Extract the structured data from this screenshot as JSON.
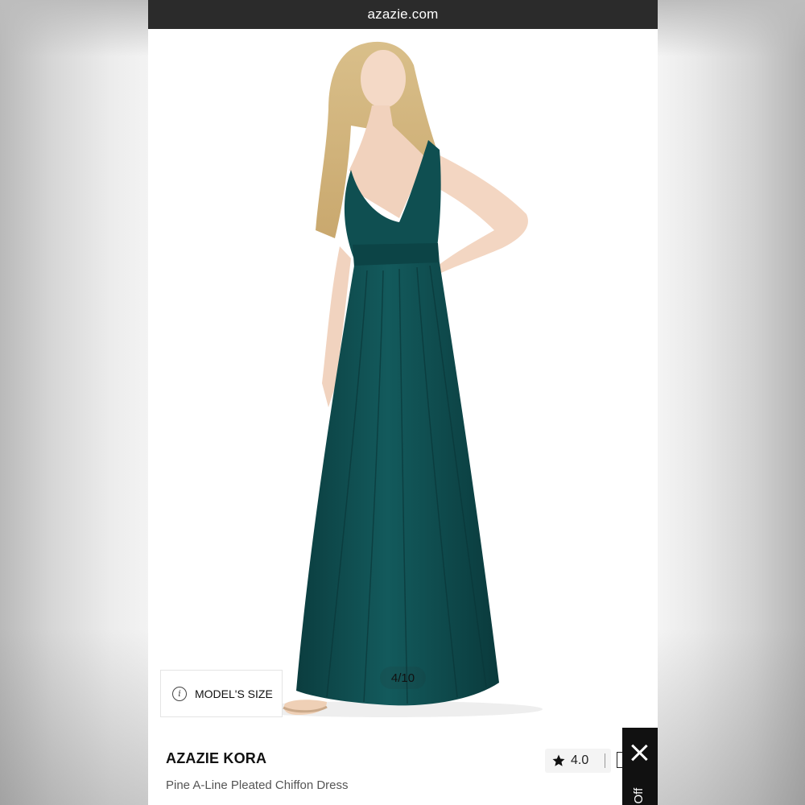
{
  "browser": {
    "url": "azazie.com"
  },
  "gallery": {
    "models_size_label": "MODEL'S SIZE",
    "counter": "4/10",
    "dress_color": "#0f4a4c",
    "image_subject": "model-wearing-dress"
  },
  "product": {
    "brand": "AZAZIE KORA",
    "name": "Pine A-Line Pleated Chiffon Dress",
    "rating": "4.0"
  },
  "promo": {
    "text": "% Off"
  },
  "colors": {
    "url_bar": "#2b2b2b",
    "promo_bg": "#111111",
    "dress": "#0f4a4c"
  }
}
